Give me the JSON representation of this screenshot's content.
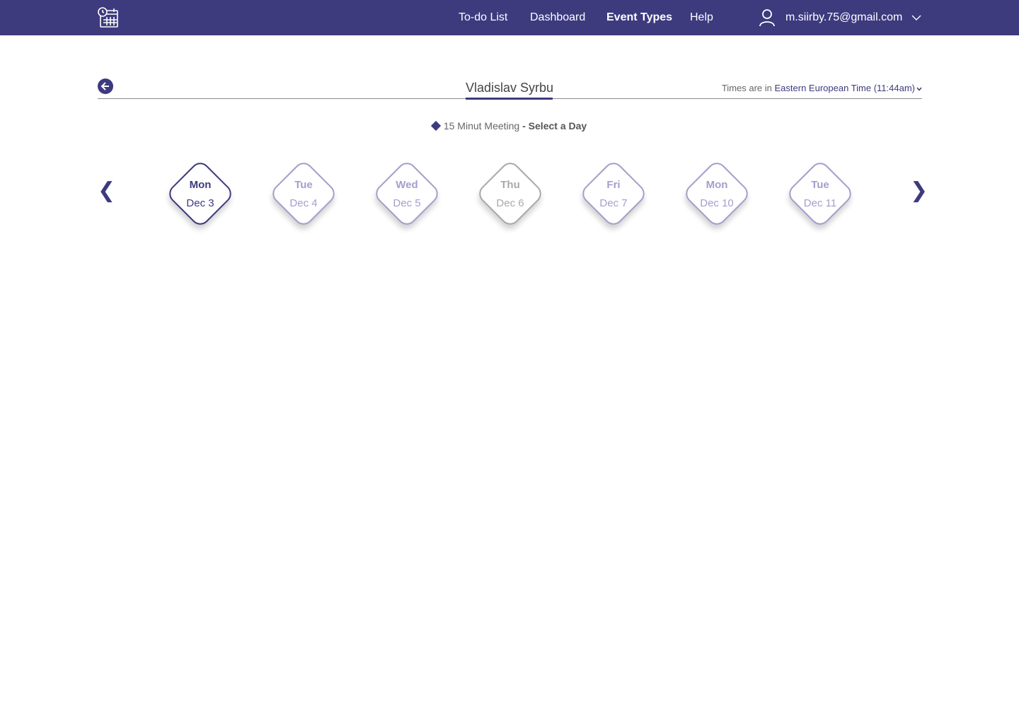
{
  "nav": {
    "logo_icon": "calendar-clock-icon",
    "links": [
      {
        "label": "To-do List",
        "active": false
      },
      {
        "label": "Dashboard",
        "active": false
      },
      {
        "label": "Event Types",
        "active": true
      },
      {
        "label": "Help",
        "active": false
      }
    ],
    "user_icon": "user-icon",
    "user_email": "m.siirby.75@gmail.com"
  },
  "header": {
    "back_icon": "arrow-left-circle-icon",
    "owner_name": "Vladislav Syrbu",
    "timezone_prefix": "Times are in",
    "timezone_value": "Eastern European Time (11:44am)"
  },
  "event": {
    "name": "15 Minut Meeting",
    "separator": " - Select a Day"
  },
  "carousel": {
    "prev_glyph": "❮",
    "next_glyph": "❯",
    "days": [
      {
        "dow": "Mon",
        "date": "Dec 3",
        "state": "selected"
      },
      {
        "dow": "Tue",
        "date": "Dec 4",
        "state": "available"
      },
      {
        "dow": "Wed",
        "date": "Dec 5",
        "state": "available"
      },
      {
        "dow": "Thu",
        "date": "Dec 6",
        "state": "muted"
      },
      {
        "dow": "Fri",
        "date": "Dec 7",
        "state": "available"
      },
      {
        "dow": "Mon",
        "date": "Dec 10",
        "state": "available"
      },
      {
        "dow": "Tue",
        "date": "Dec 11",
        "state": "available"
      }
    ]
  },
  "colors": {
    "brand": "#3d3a7e",
    "available": "#a39fcc",
    "muted": "#a9a9a9"
  }
}
